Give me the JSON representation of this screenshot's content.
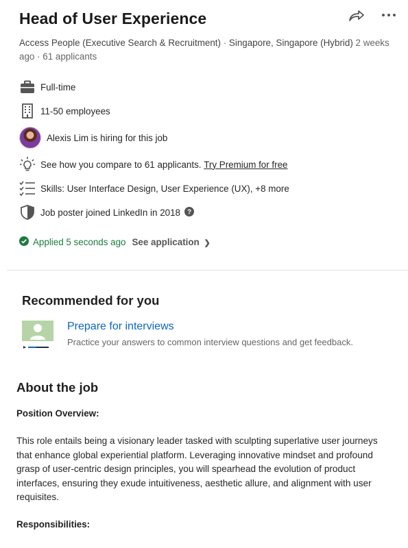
{
  "job": {
    "title": "Head of User Experience",
    "company": "Access People (Executive Search & Recruitment)",
    "location": "Singapore, Singapore (Hybrid)",
    "posted": "2 weeks ago",
    "applicants": "61 applicants",
    "separator": "·"
  },
  "insights": {
    "employment_type": "Full-time",
    "company_size": "11-50 employees",
    "hiring_person": "Alexis Lim is hiring for this job",
    "compare_text": "See how you compare to 61 applicants.",
    "premium_link": "Try Premium for free",
    "skills": "Skills: User Interface Design, User Experience (UX), +8 more",
    "poster_joined": "Job poster joined LinkedIn in 2018"
  },
  "application": {
    "status": "Applied 5 seconds ago",
    "see_application": "See application",
    "chevron": "❯"
  },
  "recommended": {
    "heading": "Recommended for you",
    "link": "Prepare for interviews",
    "description": "Practice your answers to common interview questions and get feedback."
  },
  "about": {
    "heading": "About the job",
    "position_heading": "Position Overview:",
    "paragraph": "This role entails being a visionary leader tasked with sculpting superlative user journeys that enhance global experiential platform. Leveraging innovative mindset and profound grasp of user-centric design principles, you will spearhead the evolution of product interfaces, ensuring they exude intuitiveness, aesthetic allure, and alignment with user requisites.",
    "responsibilities_heading": "Responsibilities:"
  },
  "colors": {
    "link_blue": "#0a66c2",
    "success_green": "#1d7a3f",
    "text_primary": "#1f1f1f",
    "text_muted": "#666666"
  },
  "icons": {
    "share": "share-arrow-icon",
    "more": "more-dots-icon",
    "briefcase": "briefcase-icon",
    "building": "building-icon",
    "lightbulb": "lightbulb-icon",
    "checklist": "checklist-icon",
    "shield": "shield-icon",
    "help": "question-circle-icon",
    "check": "check-circle-icon",
    "interview": "interview-prep-icon"
  }
}
